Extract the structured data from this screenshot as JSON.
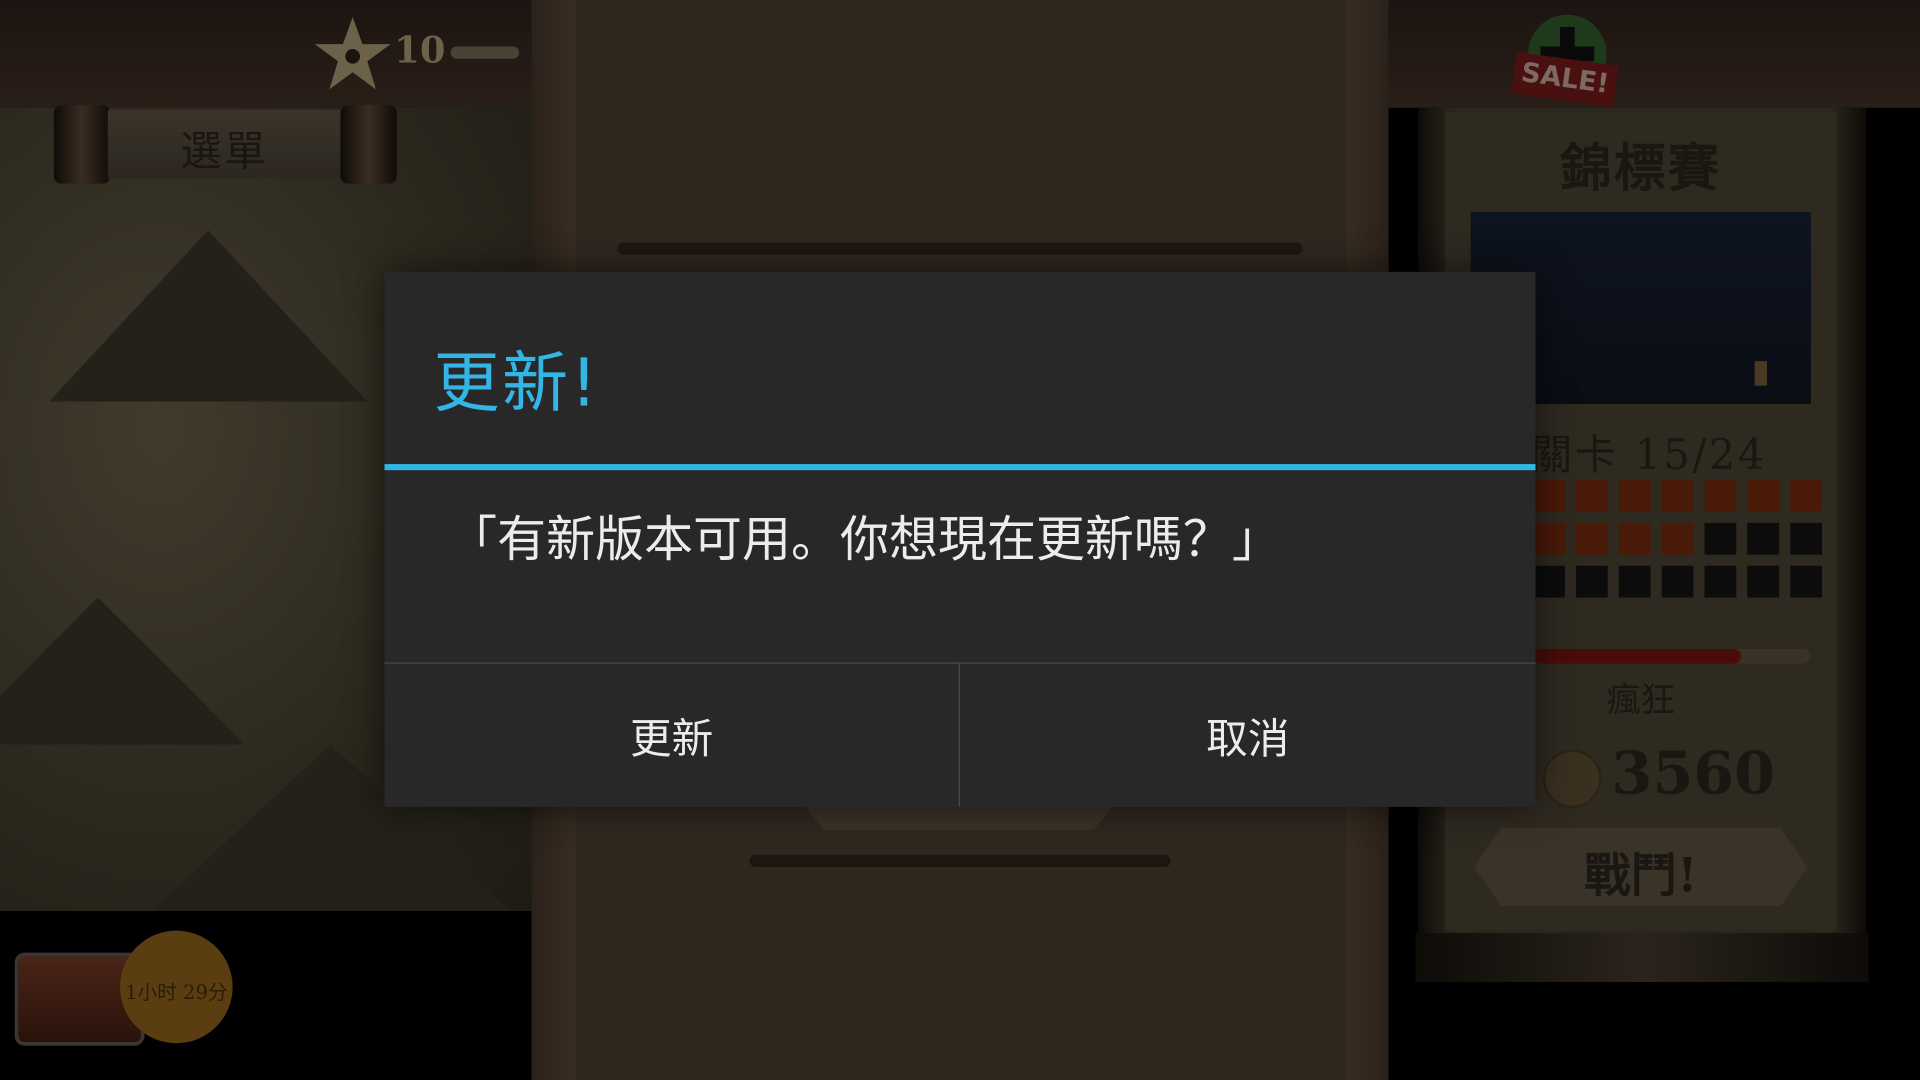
{
  "background": {
    "stars": "10",
    "menu_label": "選單",
    "timer": "1小时 29分",
    "sale_badge": "SALE!",
    "championship": {
      "title": "錦標賽",
      "level": "關卡 15/24",
      "progress": 0.75,
      "grid_completed": 11,
      "grid_total": 21,
      "mode": "瘋狂",
      "coins": "3560",
      "fight_label": "戰鬥!"
    }
  },
  "dialog": {
    "title": "更新!",
    "message": "「有新版本可用。你想現在更新嗎？」",
    "update_label": "更新",
    "cancel_label": "取消",
    "accent_color": "#33b5e5"
  },
  "icons": [
    "star-icon",
    "plus-icon",
    "coin-icon",
    "chest-icon"
  ]
}
